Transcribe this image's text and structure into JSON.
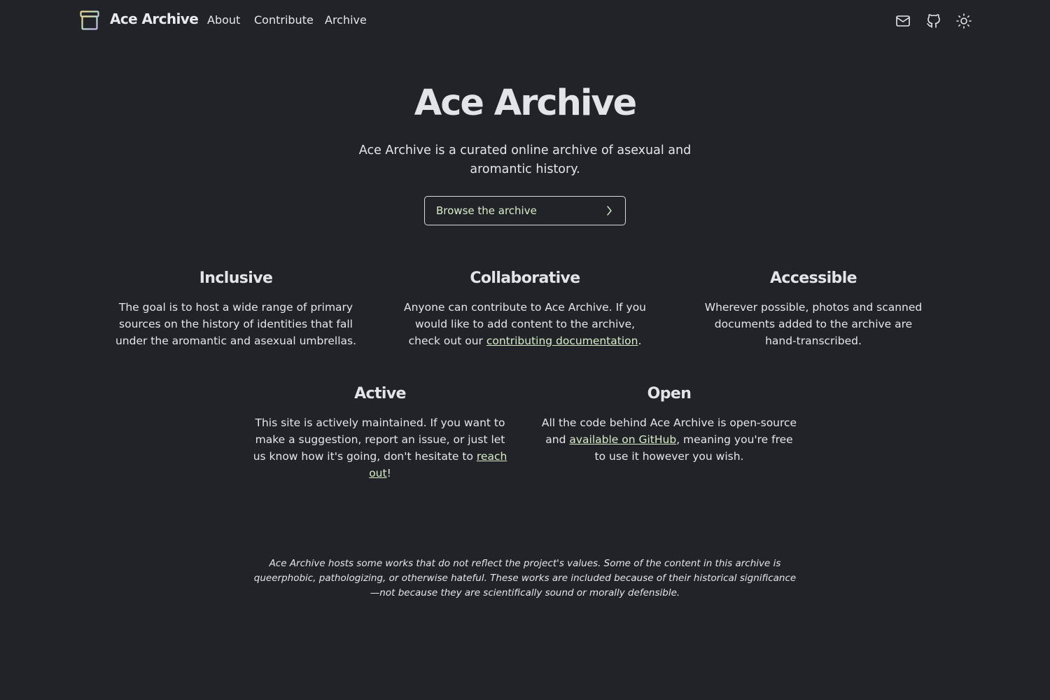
{
  "nav": {
    "brand": "Ace Archive",
    "links": [
      "About",
      "Contribute",
      "Archive"
    ],
    "icons": [
      "mail-icon",
      "github-icon",
      "sun-icon"
    ]
  },
  "hero": {
    "title": "Ace Archive",
    "subtitle": "Ace Archive is a curated online archive of asexual and aromantic history.",
    "button_label": "Browse the archive"
  },
  "features": {
    "inclusive": {
      "title": "Inclusive",
      "text": "The goal is to host a wide range of primary sources on the history of identities that fall under the aromantic and asexual umbrellas."
    },
    "collaborative": {
      "title": "Collaborative",
      "text_before": "Anyone can contribute to Ace Archive. If you would like to add content to the archive, check out our ",
      "link": "contributing documentation",
      "text_after": "."
    },
    "accessible": {
      "title": "Accessible",
      "text": "Wherever possible, photos and scanned documents added to the archive are hand-transcribed."
    },
    "active": {
      "title": "Active",
      "text_before": "This site is actively maintained. If you want to make a suggestion, report an issue, or just let us know how it's going, don't hesitate to ",
      "link": "reach out",
      "text_after": "!"
    },
    "open": {
      "title": "Open",
      "text_before": "All the code behind Ace Archive is open-source and ",
      "link": "available on GitHub",
      "text_after": ", meaning you're free to use it however you wish."
    }
  },
  "disclaimer": "Ace Archive hosts some works that do not reflect the project's values. Some of the content in this archive is queerphobic, pathologizing, or otherwise hateful. These works are included because of their historical significance—not because they are scientifically sound or morally defensible.",
  "colors": {
    "background": "#212328",
    "text": "#e6e7ea",
    "link_accent": "#d8edc8"
  }
}
